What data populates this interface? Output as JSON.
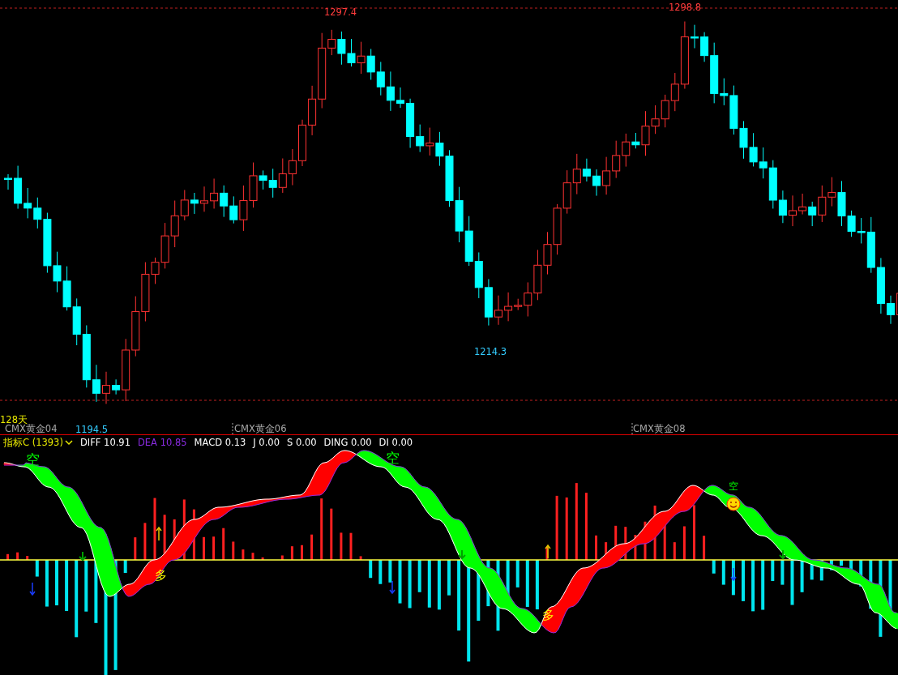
{
  "price_chart": {
    "marks": [
      {
        "kind": "high",
        "text": "1297.4"
      },
      {
        "kind": "high",
        "text": "1298.8"
      },
      {
        "kind": "low",
        "text": "1214.3"
      },
      {
        "kind": "low",
        "text": "1194.5"
      }
    ],
    "period": "128天",
    "contracts": [
      "CMX黄金04",
      "CMX黄金06",
      "CMX黄金08"
    ]
  },
  "indicator": {
    "name": "指标C (1393)",
    "values": [
      {
        "kind": "diff",
        "text": "DIFF 10.91"
      },
      {
        "kind": "dea",
        "text": "DEA 10.85"
      },
      {
        "kind": "macd",
        "text": "MACD 0.13"
      },
      {
        "kind": "plain",
        "text": "J 0.00"
      },
      {
        "kind": "plain",
        "text": "S 0.00"
      },
      {
        "kind": "plain",
        "text": "DING 0.00"
      },
      {
        "kind": "plain",
        "text": "DI 0.00"
      }
    ]
  },
  "signals": [
    {
      "kind": "short",
      "text": "空"
    },
    {
      "kind": "long",
      "text": "多"
    },
    {
      "kind": "short",
      "text": "空"
    },
    {
      "kind": "long",
      "text": "多"
    },
    {
      "kind": "short",
      "text": "空"
    }
  ]
}
